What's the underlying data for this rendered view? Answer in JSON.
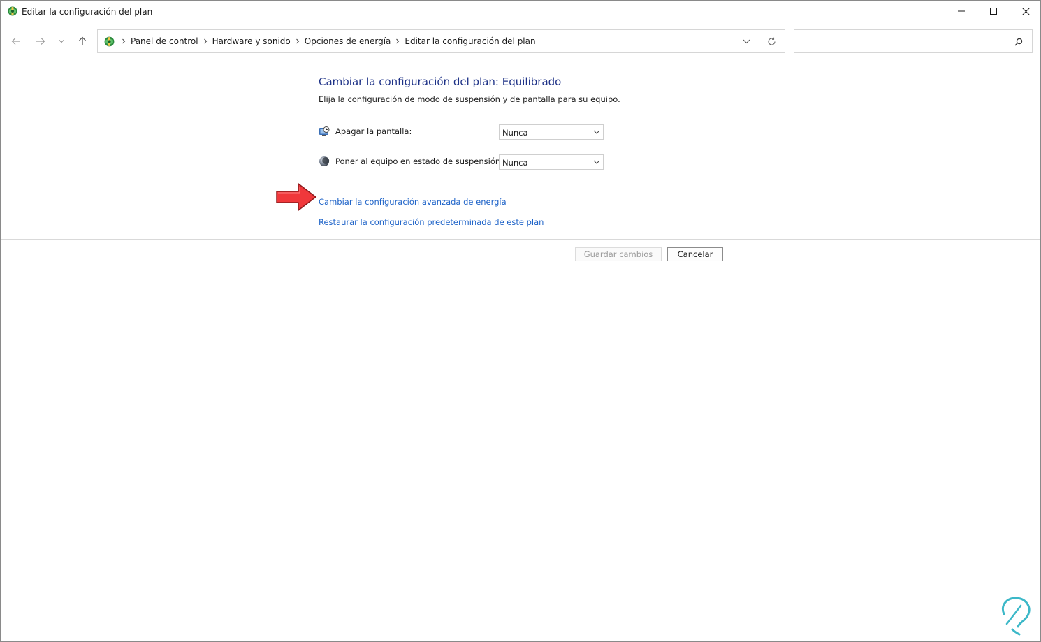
{
  "window": {
    "title": "Editar la configuración del plan",
    "caption_buttons": [
      "minimize-icon",
      "maximize-icon",
      "close-icon"
    ]
  },
  "navigation": {
    "icons": [
      "arrow-left-icon",
      "arrow-right-icon",
      "chevron-down-icon",
      "arrow-up-icon"
    ],
    "breadcrumbs": [
      "Panel de control",
      "Hardware y sonido",
      "Opciones de energía",
      "Editar la configuración del plan"
    ],
    "address_icons": [
      "control-panel-icon",
      "chevron-down-icon",
      "refresh-icon"
    ]
  },
  "search": {
    "value": "",
    "placeholder": "",
    "icon": "search-icon"
  },
  "plan": {
    "heading": "Cambiar la configuración del plan: Equilibrado",
    "description": "Elija la configuración de modo de suspensión y de pantalla para su equipo.",
    "settings": [
      {
        "icon": "display-timer-icon",
        "label": "Apagar la pantalla:",
        "value": "Nunca"
      },
      {
        "icon": "sleep-moon-icon",
        "label": "Poner al equipo en estado de suspensión:",
        "value": "Nunca"
      }
    ],
    "links": {
      "advanced": "Cambiar la configuración avanzada de energía",
      "restore": "Restaurar la configuración predeterminada de este plan"
    }
  },
  "buttons": {
    "save": "Guardar cambios",
    "cancel": "Cancelar"
  },
  "colors": {
    "heading": "#1e3287",
    "link": "#1e63c8",
    "annotation_arrow": "#f0383b",
    "watermark": "#3cb8c8"
  }
}
